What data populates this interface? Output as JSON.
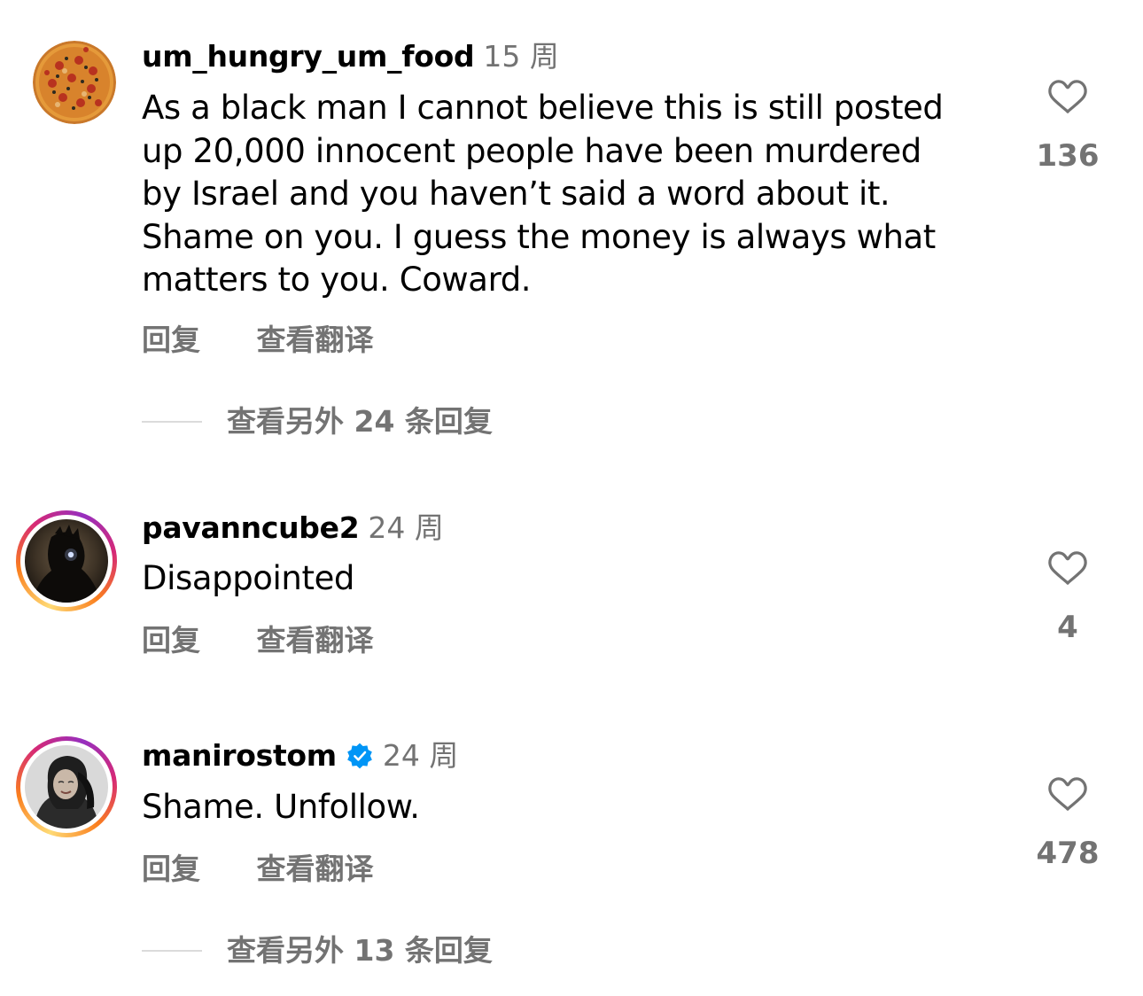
{
  "comments": [
    {
      "username": "um_hungry_um_food",
      "time": "15 周",
      "lines": [
        "As a black man I cannot believe this is still posted",
        "up 20,000 innocent people have been murdered",
        "by Israel and you haven’t said a word about it.",
        "Shame on you. I guess the money is always what",
        "matters to you. Coward."
      ],
      "reply_label": "回复",
      "translate_label": "查看翻译",
      "likes": "136",
      "view_replies": "查看另外 24 条回复",
      "avatar": "pizza-avatar"
    },
    {
      "username": "pavanncube2",
      "time": "24 周",
      "lines": [
        "Disappointed"
      ],
      "reply_label": "回复",
      "translate_label": "查看翻译",
      "likes": "4",
      "avatar": "dark-figure-avatar"
    },
    {
      "username": "manirostom",
      "verified": true,
      "time": "24 周",
      "lines": [
        "Shame. Unfollow."
      ],
      "reply_label": "回复",
      "translate_label": "查看翻译",
      "likes": "478",
      "view_replies": "查看另外 13 条回复",
      "avatar": "portrait-avatar"
    }
  ],
  "colors": {
    "text": "#000000",
    "secondary": "#737373",
    "divider": "#dbdbdb",
    "verified": "#0095f6",
    "story_ring": [
      "#feda75",
      "#fa7e1e",
      "#d62976",
      "#962fbf"
    ]
  },
  "icons": {
    "like": "heart-outline-icon",
    "verified": "verified-badge-icon"
  }
}
